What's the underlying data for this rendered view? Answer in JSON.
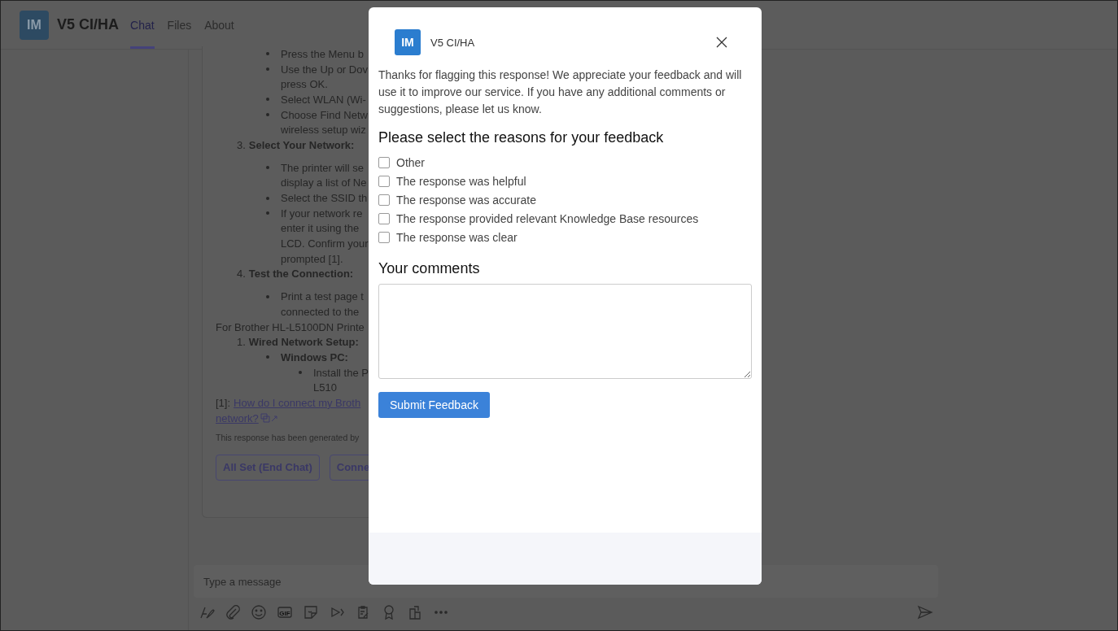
{
  "app": {
    "logo": "IM",
    "title": "V5 CI/HA"
  },
  "tabs": [
    {
      "label": "Chat",
      "selected": true
    },
    {
      "label": "Files",
      "selected": false
    },
    {
      "label": "About",
      "selected": false
    }
  ],
  "chat": {
    "lines": [
      {
        "kind": "bullet",
        "text": "Press the Menu b"
      },
      {
        "kind": "bullet",
        "text": "Use the Up or Dov"
      },
      {
        "kind": "continuation",
        "text": "press OK."
      },
      {
        "kind": "bullet",
        "text": "Select WLAN (Wi-"
      },
      {
        "kind": "bullet",
        "text": "Choose Find Netw"
      },
      {
        "kind": "continuation",
        "text": "wireless setup wiz"
      },
      {
        "kind": "step",
        "number": "3.",
        "text": "Select Your Network:"
      },
      {
        "kind": "gap"
      },
      {
        "kind": "bullet",
        "text": "The printer will se"
      },
      {
        "kind": "continuation",
        "text": "display a list of Ne"
      },
      {
        "kind": "bullet",
        "text": "Select the SSID th"
      },
      {
        "kind": "bullet",
        "text": "If your network re"
      },
      {
        "kind": "continuation",
        "text": "enter it using the"
      },
      {
        "kind": "continuation",
        "text": "LCD. Confirm your"
      },
      {
        "kind": "continuation",
        "text": "prompted [1]."
      },
      {
        "kind": "step",
        "number": "4.",
        "text": "Test the Connection:"
      },
      {
        "kind": "gap"
      },
      {
        "kind": "bullet",
        "text": "Print a test page t"
      },
      {
        "kind": "continuation",
        "text": "connected to the"
      },
      {
        "kind": "plain",
        "text": "For Brother HL-L5100DN Printe"
      },
      {
        "kind": "step",
        "number": "1.",
        "text": "Wired Network Setup:"
      },
      {
        "kind": "subhead",
        "text": "Windows PC:"
      },
      {
        "kind": "subbullet",
        "text": "Install the P"
      },
      {
        "kind": "subcontinuation",
        "text": "L510"
      }
    ],
    "reference": {
      "prefix": "[1]:",
      "link": "How do I connect my Broth",
      "link_cont": "network?"
    },
    "disclaimer": "This response has been generated by",
    "buttons": [
      "All Set (End Chat)",
      "Conne"
    ]
  },
  "composer": {
    "placeholder": "Type a message",
    "gif_label": "GIF"
  },
  "dialog": {
    "logo": "IM",
    "title": "V5 CI/HA",
    "message": "Thanks for flagging this response! We appreciate your feedback and will use it to improve our service. If you have any additional comments or suggestions, please let us know.",
    "reasons_heading": "Please select the reasons for your feedback",
    "reasons": [
      {
        "label": "Other",
        "checked": false
      },
      {
        "label": "The response was helpful",
        "checked": false
      },
      {
        "label": "The response was accurate",
        "checked": false
      },
      {
        "label": "The response provided relevant Knowledge Base resources",
        "checked": false
      },
      {
        "label": "The response was clear",
        "checked": false
      }
    ],
    "comments_heading": "Your comments",
    "submit": "Submit Feedback"
  }
}
